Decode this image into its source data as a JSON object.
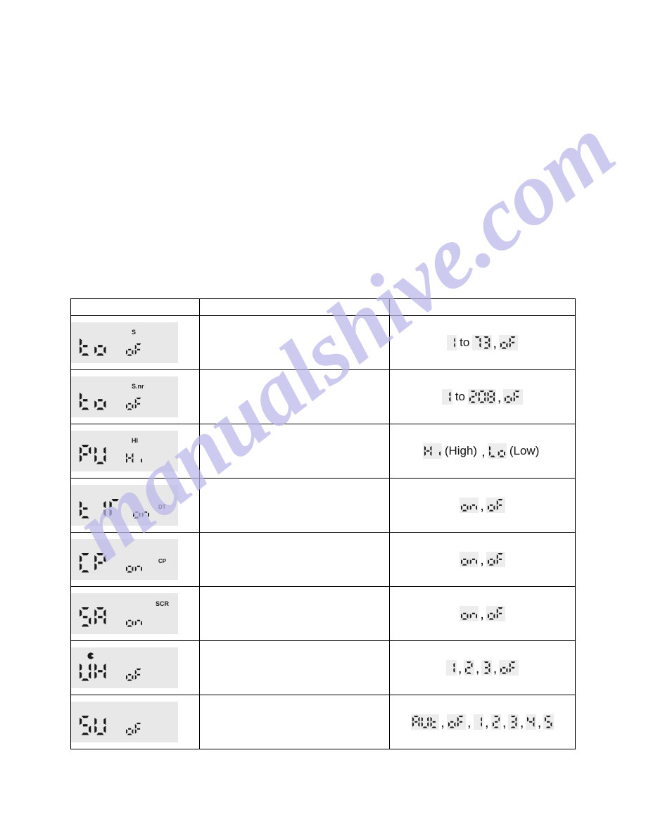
{
  "page": {
    "watermark_text": "manualshive.com",
    "background_color": "#ffffff",
    "lcd_panel_color": "#e8e8e8",
    "segment_highlight_color": "#ededed",
    "segment_ink_color": "#1a1a1a"
  },
  "table": {
    "header": {
      "col1": "",
      "col2": "",
      "col3": ""
    },
    "rows": [
      {
        "display": {
          "main": "to",
          "value": "oF",
          "annunciator": "S",
          "annunciator_position": "above-value"
        },
        "description": "",
        "range": {
          "text": "1 to 73 , oF",
          "parts": [
            {
              "kind": "seg",
              "text": "1"
            },
            {
              "kind": "plain",
              "text": "to"
            },
            {
              "kind": "seg",
              "text": "73"
            },
            {
              "kind": "comma",
              "text": ","
            },
            {
              "kind": "seg",
              "text": "oF"
            }
          ]
        }
      },
      {
        "display": {
          "main": "to",
          "value": "oF",
          "annunciator": "S.nr",
          "annunciator_position": "above-value"
        },
        "description": "",
        "range": {
          "text": "1 to 208 , oF",
          "parts": [
            {
              "kind": "seg",
              "text": "1"
            },
            {
              "kind": "plain",
              "text": "to"
            },
            {
              "kind": "seg",
              "text": "208"
            },
            {
              "kind": "comma",
              "text": ","
            },
            {
              "kind": "seg",
              "text": "oF"
            }
          ]
        }
      },
      {
        "display": {
          "main": "PW",
          "value": "Hi",
          "annunciator": "HI",
          "annunciator_position": "above-value"
        },
        "description": "",
        "range": {
          "text": "Hi (High), Lo (Low)",
          "parts": [
            {
              "kind": "seg",
              "text": "Hi"
            },
            {
              "kind": "plain",
              "text": "(High)"
            },
            {
              "kind": "comma",
              "text": ","
            },
            {
              "kind": "seg",
              "text": "Lo"
            },
            {
              "kind": "plain",
              "text": "(Low)"
            }
          ]
        }
      },
      {
        "display": {
          "main": "TIM",
          "value": "on",
          "annunciator": "DT",
          "annunciator_position": "superscript"
        },
        "description": "",
        "range": {
          "text": "on , oF",
          "parts": [
            {
              "kind": "seg",
              "text": "on"
            },
            {
              "kind": "comma",
              "text": ","
            },
            {
              "kind": "seg",
              "text": "oF"
            }
          ]
        }
      },
      {
        "display": {
          "main": "CP",
          "value": "on",
          "annunciator": "CP",
          "annunciator_position": "superscript"
        },
        "description": "",
        "range": {
          "text": "on , oF",
          "parts": [
            {
              "kind": "seg",
              "text": "on"
            },
            {
              "kind": "comma",
              "text": ","
            },
            {
              "kind": "seg",
              "text": "oF"
            }
          ]
        }
      },
      {
        "display": {
          "main": "SR",
          "value": "on",
          "annunciator": "SCR",
          "annunciator_position": "above-right"
        },
        "description": "",
        "range": {
          "text": "on , oF",
          "parts": [
            {
              "kind": "seg",
              "text": "on"
            },
            {
              "kind": "comma",
              "text": ","
            },
            {
              "kind": "seg",
              "text": "oF"
            }
          ]
        }
      },
      {
        "display": {
          "main": "VX",
          "value": "oF",
          "annunciator": "fan-icon",
          "annunciator_position": "above-main"
        },
        "description": "",
        "range": {
          "text": "1, 2, 3, oF",
          "parts": [
            {
              "kind": "seg",
              "text": "1"
            },
            {
              "kind": "comma",
              "text": ","
            },
            {
              "kind": "seg",
              "text": "2"
            },
            {
              "kind": "comma",
              "text": ","
            },
            {
              "kind": "seg",
              "text": "3"
            },
            {
              "kind": "comma",
              "text": ","
            },
            {
              "kind": "seg",
              "text": "oF"
            }
          ]
        }
      },
      {
        "display": {
          "main": "SW",
          "value": "oF",
          "annunciator": "",
          "annunciator_position": "none"
        },
        "description": "",
        "range": {
          "text": "AUt,oF,1,2,3,4,5",
          "parts": [
            {
              "kind": "seg",
              "text": "AUt"
            },
            {
              "kind": "comma",
              "text": ","
            },
            {
              "kind": "seg",
              "text": "oF"
            },
            {
              "kind": "comma",
              "text": ","
            },
            {
              "kind": "seg",
              "text": "1"
            },
            {
              "kind": "comma",
              "text": ","
            },
            {
              "kind": "seg",
              "text": "2"
            },
            {
              "kind": "comma",
              "text": ","
            },
            {
              "kind": "seg",
              "text": "3"
            },
            {
              "kind": "comma",
              "text": ","
            },
            {
              "kind": "seg",
              "text": "4"
            },
            {
              "kind": "comma",
              "text": ","
            },
            {
              "kind": "seg",
              "text": "5"
            }
          ]
        }
      }
    ]
  }
}
